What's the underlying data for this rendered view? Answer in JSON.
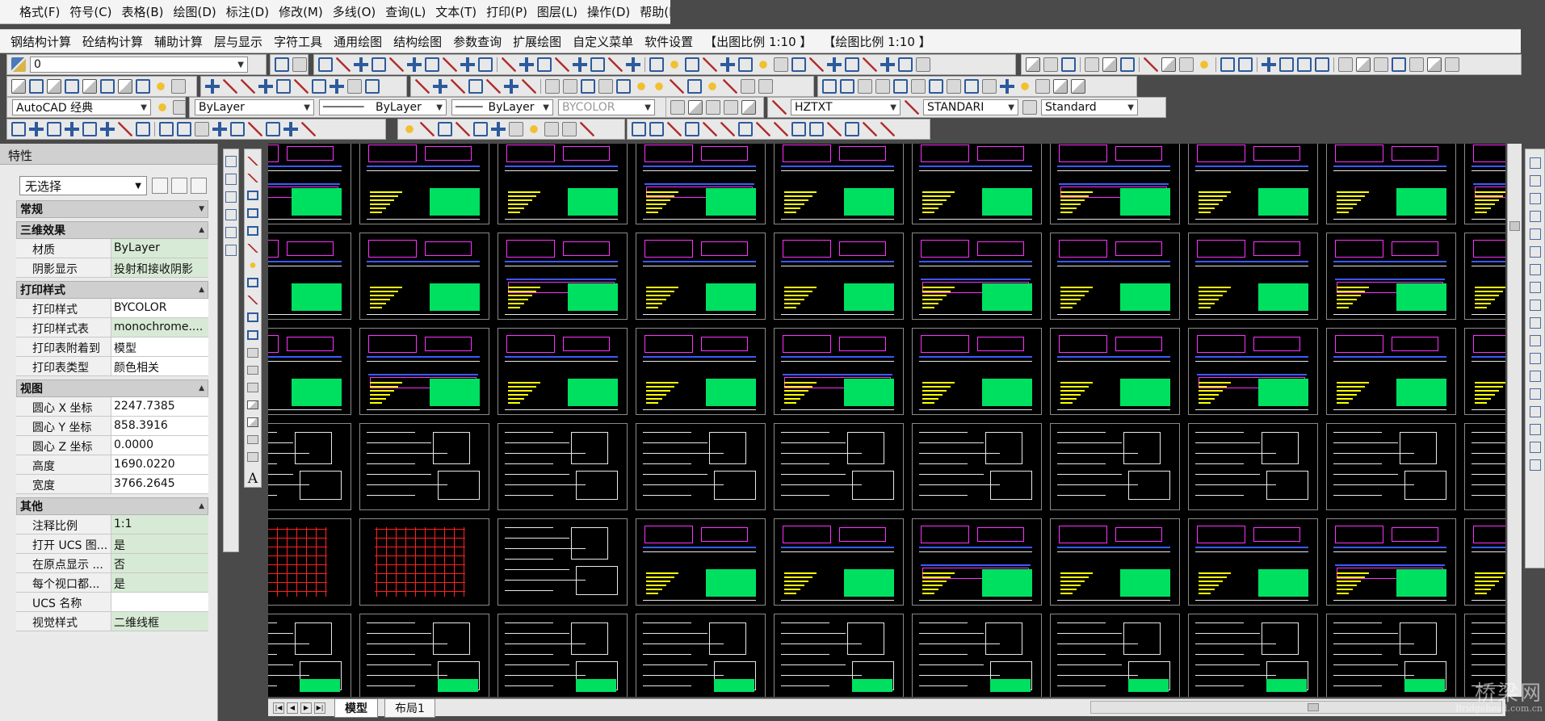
{
  "menubar": {
    "items": [
      "格式(F)",
      "符号(C)",
      "表格(B)",
      "绘图(D)",
      "标注(D)",
      "修改(M)",
      "多线(O)",
      "查询(L)",
      "文本(T)",
      "打印(P)",
      "图层(L)",
      "操作(D)",
      "帮助(H)"
    ]
  },
  "custom_menu": {
    "items": [
      "钢结构计算",
      "砼结构计算",
      "辅助计算",
      "层与显示",
      "字符工具",
      "通用绘图",
      "结构绘图",
      "参数查询",
      "扩展绘图",
      "自定义菜单",
      "软件设置",
      "【出图比例 1:10 】",
      "【绘图比例 1:10 】"
    ]
  },
  "toolbars": {
    "layer_combo": "0",
    "workspace": "AutoCAD 经典",
    "layer_prop": "ByLayer",
    "linetype": "ByLayer",
    "lineweight": "ByLayer",
    "plotstyle": "BYCOLOR",
    "text_style": "HZTXT",
    "dim_style": "STANDARI",
    "table_style": "Standard"
  },
  "properties": {
    "title": "特性",
    "selection": "无选择",
    "sections": [
      {
        "name": "常规",
        "rows": []
      },
      {
        "name": "三维效果",
        "rows": [
          {
            "k": "材质",
            "v": "ByLayer"
          },
          {
            "k": "阴影显示",
            "v": "投射和接收阴影"
          }
        ]
      },
      {
        "name": "打印样式",
        "rows": [
          {
            "k": "打印样式",
            "v": "BYCOLOR"
          },
          {
            "k": "打印样式表",
            "v": "monochrome...."
          },
          {
            "k": "打印表附着到",
            "v": "模型"
          },
          {
            "k": "打印表类型",
            "v": "颜色相关"
          }
        ]
      },
      {
        "name": "视图",
        "rows": [
          {
            "k": "圆心 X 坐标",
            "v": "2247.7385"
          },
          {
            "k": "圆心 Y 坐标",
            "v": "858.3916"
          },
          {
            "k": "圆心 Z 坐标",
            "v": "0.0000"
          },
          {
            "k": "高度",
            "v": "1690.0220"
          },
          {
            "k": "宽度",
            "v": "3766.2645"
          }
        ]
      },
      {
        "name": "其他",
        "rows": [
          {
            "k": "注释比例",
            "v": "1:1"
          },
          {
            "k": "打开 UCS 图...",
            "v": "是"
          },
          {
            "k": "在原点显示 ...",
            "v": "否"
          },
          {
            "k": "每个视口都...",
            "v": "是"
          },
          {
            "k": "UCS 名称",
            "v": ""
          },
          {
            "k": "视觉样式",
            "v": "二维线框"
          }
        ]
      }
    ]
  },
  "tabs": {
    "model": "模型",
    "layout1": "布局1"
  },
  "watermark": {
    "big": "桥梁网",
    "small": "Bridgehead.com.cn"
  }
}
